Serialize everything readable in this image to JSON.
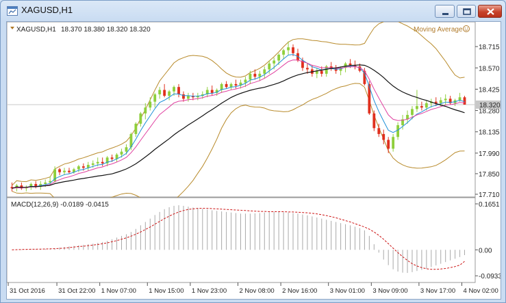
{
  "window": {
    "title": "XAGUSD,H1"
  },
  "chart_data": {
    "type": "candlestick",
    "symbol_header": "XAGUSD,H1",
    "ohlc_header": "18.370 18.380 18.320 18.320",
    "indicator_label": "Moving Average",
    "price_axis_ticks": [
      "18.715",
      "18.570",
      "18.425",
      "18.280",
      "18.135",
      "17.990",
      "17.850",
      "17.710"
    ],
    "price_axis_values": [
      18.715,
      18.57,
      18.425,
      18.28,
      18.135,
      17.99,
      17.85,
      17.71
    ],
    "current_price": "18.320",
    "time_labels": [
      "31 Oct 2016",
      "31 Oct 22:00",
      "1 Nov 07:00",
      "1 Nov 15:00",
      "1 Nov 23:00",
      "2 Nov 08:00",
      "2 Nov 16:00",
      "3 Nov 01:00",
      "3 Nov 09:00",
      "3 Nov 17:00",
      "4 Nov 02:00"
    ],
    "ylim": [
      17.71,
      18.79
    ],
    "candles": [
      [
        17.76,
        17.79,
        17.73,
        17.75
      ],
      [
        17.75,
        17.78,
        17.73,
        17.77
      ],
      [
        17.77,
        17.79,
        17.74,
        17.75
      ],
      [
        17.75,
        17.77,
        17.73,
        17.76
      ],
      [
        17.76,
        17.79,
        17.74,
        17.78
      ],
      [
        17.78,
        17.8,
        17.75,
        17.76
      ],
      [
        17.76,
        17.8,
        17.74,
        17.78
      ],
      [
        17.78,
        17.81,
        17.76,
        17.79
      ],
      [
        17.79,
        17.83,
        17.77,
        17.8
      ],
      [
        17.8,
        17.9,
        17.79,
        17.88
      ],
      [
        17.88,
        17.89,
        17.84,
        17.86
      ],
      [
        17.86,
        17.89,
        17.84,
        17.87
      ],
      [
        17.87,
        17.89,
        17.85,
        17.86
      ],
      [
        17.86,
        17.89,
        17.85,
        17.88
      ],
      [
        17.88,
        17.91,
        17.86,
        17.9
      ],
      [
        17.9,
        17.92,
        17.87,
        17.89
      ],
      [
        17.89,
        17.93,
        17.87,
        17.91
      ],
      [
        17.91,
        17.94,
        17.89,
        17.92
      ],
      [
        17.92,
        17.96,
        17.9,
        17.93
      ],
      [
        17.93,
        17.96,
        17.9,
        17.92
      ],
      [
        17.92,
        17.97,
        17.9,
        17.96
      ],
      [
        17.96,
        17.98,
        17.93,
        17.95
      ],
      [
        17.95,
        17.99,
        17.93,
        17.98
      ],
      [
        17.98,
        18.02,
        17.96,
        18.0
      ],
      [
        18.0,
        18.05,
        17.98,
        18.03
      ],
      [
        18.03,
        18.13,
        18.01,
        18.12
      ],
      [
        18.12,
        18.2,
        18.1,
        18.19
      ],
      [
        18.19,
        18.27,
        18.17,
        18.26
      ],
      [
        18.26,
        18.33,
        18.22,
        18.3
      ],
      [
        18.3,
        18.37,
        18.28,
        18.34
      ],
      [
        18.34,
        18.4,
        18.3,
        18.39
      ],
      [
        18.39,
        18.44,
        18.36,
        18.42
      ],
      [
        18.42,
        18.46,
        18.37,
        18.38
      ],
      [
        18.38,
        18.42,
        18.35,
        18.41
      ],
      [
        18.41,
        18.45,
        18.38,
        18.44
      ],
      [
        18.44,
        18.46,
        18.37,
        18.39
      ],
      [
        18.39,
        18.41,
        18.34,
        18.36
      ],
      [
        18.36,
        18.4,
        18.34,
        18.38
      ],
      [
        18.38,
        18.4,
        18.35,
        18.37
      ],
      [
        18.37,
        18.4,
        18.35,
        18.38
      ],
      [
        18.38,
        18.41,
        18.36,
        18.39
      ],
      [
        18.39,
        18.44,
        18.37,
        18.42
      ],
      [
        18.42,
        18.45,
        18.38,
        18.4
      ],
      [
        18.4,
        18.43,
        18.38,
        18.42
      ],
      [
        18.42,
        18.47,
        18.4,
        18.46
      ],
      [
        18.46,
        18.48,
        18.43,
        18.44
      ],
      [
        18.44,
        18.47,
        18.42,
        18.46
      ],
      [
        18.46,
        18.49,
        18.43,
        18.45
      ],
      [
        18.45,
        18.49,
        18.43,
        18.47
      ],
      [
        18.47,
        18.51,
        18.44,
        18.49
      ],
      [
        18.49,
        18.55,
        18.46,
        18.53
      ],
      [
        18.53,
        18.56,
        18.49,
        18.51
      ],
      [
        18.51,
        18.55,
        18.48,
        18.53
      ],
      [
        18.53,
        18.58,
        18.5,
        18.56
      ],
      [
        18.56,
        18.62,
        18.53,
        18.6
      ],
      [
        18.6,
        18.64,
        18.56,
        18.62
      ],
      [
        18.62,
        18.67,
        18.59,
        18.66
      ],
      [
        18.66,
        18.7,
        18.63,
        18.69
      ],
      [
        18.69,
        18.75,
        18.66,
        18.71
      ],
      [
        18.71,
        18.73,
        18.65,
        18.67
      ],
      [
        18.67,
        18.7,
        18.61,
        18.62
      ],
      [
        18.62,
        18.64,
        18.55,
        18.57
      ],
      [
        18.57,
        18.6,
        18.53,
        18.56
      ],
      [
        18.56,
        18.59,
        18.51,
        18.53
      ],
      [
        18.53,
        18.57,
        18.5,
        18.55
      ],
      [
        18.55,
        18.58,
        18.51,
        18.53
      ],
      [
        18.53,
        18.59,
        18.51,
        18.58
      ],
      [
        18.58,
        18.61,
        18.55,
        18.57
      ],
      [
        18.57,
        18.59,
        18.53,
        18.55
      ],
      [
        18.55,
        18.58,
        18.52,
        18.57
      ],
      [
        18.57,
        18.61,
        18.54,
        18.6
      ],
      [
        18.6,
        18.63,
        18.57,
        18.59
      ],
      [
        18.59,
        18.62,
        18.56,
        18.58
      ],
      [
        18.58,
        18.6,
        18.54,
        18.55
      ],
      [
        18.55,
        18.57,
        18.45,
        18.46
      ],
      [
        18.46,
        18.48,
        18.25,
        18.26
      ],
      [
        18.26,
        18.28,
        18.14,
        18.16
      ],
      [
        18.16,
        18.19,
        18.1,
        18.12
      ],
      [
        18.12,
        18.15,
        18.05,
        18.08
      ],
      [
        18.08,
        18.1,
        17.99,
        18.02
      ],
      [
        18.02,
        18.12,
        18.0,
        18.1
      ],
      [
        18.1,
        18.2,
        18.08,
        18.18
      ],
      [
        18.18,
        18.25,
        18.15,
        18.22
      ],
      [
        18.22,
        18.28,
        18.19,
        18.25
      ],
      [
        18.25,
        18.31,
        18.22,
        18.29
      ],
      [
        18.29,
        18.42,
        18.27,
        18.31
      ],
      [
        18.31,
        18.34,
        18.28,
        18.3
      ],
      [
        18.3,
        18.35,
        18.28,
        18.33
      ],
      [
        18.33,
        18.36,
        18.3,
        18.34
      ],
      [
        18.34,
        18.37,
        18.31,
        18.33
      ],
      [
        18.33,
        18.37,
        18.31,
        18.35
      ],
      [
        18.35,
        18.39,
        18.32,
        18.36
      ],
      [
        18.36,
        18.38,
        18.32,
        18.33
      ],
      [
        18.33,
        18.36,
        18.31,
        18.35
      ],
      [
        18.35,
        18.4,
        18.34,
        18.37
      ],
      [
        18.37,
        18.38,
        18.32,
        18.32
      ]
    ],
    "macd": {
      "label": "MACD(12,26,9) -0.0189 -0.0415",
      "ticks": [
        "0.1651",
        "0.00",
        "-0.0933"
      ],
      "tick_values": [
        0.1651,
        0.0,
        -0.0933
      ],
      "ylim": [
        -0.105,
        0.175
      ],
      "histogram": [
        0.0005,
        0.001,
        0.001,
        0.0015,
        0.002,
        0.002,
        0.003,
        0.003,
        0.004,
        0.006,
        0.008,
        0.01,
        0.012,
        0.014,
        0.016,
        0.018,
        0.02,
        0.022,
        0.025,
        0.028,
        0.032,
        0.038,
        0.044,
        0.05,
        0.056,
        0.064,
        0.075,
        0.088,
        0.1,
        0.112,
        0.125,
        0.136,
        0.146,
        0.153,
        0.158,
        0.16,
        0.158,
        0.155,
        0.152,
        0.15,
        0.147,
        0.145,
        0.142,
        0.14,
        0.138,
        0.136,
        0.134,
        0.132,
        0.13,
        0.13,
        0.13,
        0.131,
        0.132,
        0.134,
        0.135,
        0.136,
        0.136,
        0.135,
        0.134,
        0.132,
        0.13,
        0.127,
        0.124,
        0.12,
        0.116,
        0.112,
        0.108,
        0.104,
        0.1,
        0.096,
        0.092,
        0.088,
        0.083,
        0.078,
        0.07,
        0.05,
        0.02,
        -0.01,
        -0.035,
        -0.055,
        -0.07,
        -0.078,
        -0.082,
        -0.083,
        -0.08,
        -0.076,
        -0.072,
        -0.068,
        -0.062,
        -0.056,
        -0.05,
        -0.044,
        -0.038,
        -0.032,
        -0.026,
        -0.019
      ],
      "signal": [
        0.0,
        0.0005,
        0.001,
        0.0015,
        0.002,
        0.002,
        0.0025,
        0.003,
        0.0035,
        0.004,
        0.005,
        0.006,
        0.008,
        0.01,
        0.012,
        0.013,
        0.015,
        0.017,
        0.019,
        0.022,
        0.025,
        0.029,
        0.033,
        0.038,
        0.043,
        0.049,
        0.056,
        0.064,
        0.073,
        0.082,
        0.092,
        0.102,
        0.112,
        0.121,
        0.129,
        0.136,
        0.141,
        0.145,
        0.147,
        0.149,
        0.149,
        0.149,
        0.148,
        0.147,
        0.146,
        0.145,
        0.144,
        0.143,
        0.142,
        0.141,
        0.14,
        0.139,
        0.138,
        0.138,
        0.137,
        0.137,
        0.137,
        0.137,
        0.136,
        0.136,
        0.135,
        0.134,
        0.133,
        0.131,
        0.129,
        0.126,
        0.123,
        0.119,
        0.115,
        0.11,
        0.105,
        0.1,
        0.094,
        0.088,
        0.082,
        0.074,
        0.064,
        0.052,
        0.038,
        0.022,
        0.006,
        -0.01,
        -0.025,
        -0.038,
        -0.05,
        -0.058,
        -0.064,
        -0.068,
        -0.07,
        -0.07,
        -0.069,
        -0.067,
        -0.064,
        -0.06,
        -0.055,
        -0.0415
      ]
    }
  },
  "colors": {
    "bull": "#8fcf3c",
    "bear": "#e0301e",
    "ma_fast": "#1e90d8",
    "ma_mid": "#e040a0",
    "ma_slow": "#111111",
    "bands": "#b88a2a",
    "macd_hist": "#a8a8a8",
    "macd_signal": "#cc1111"
  }
}
